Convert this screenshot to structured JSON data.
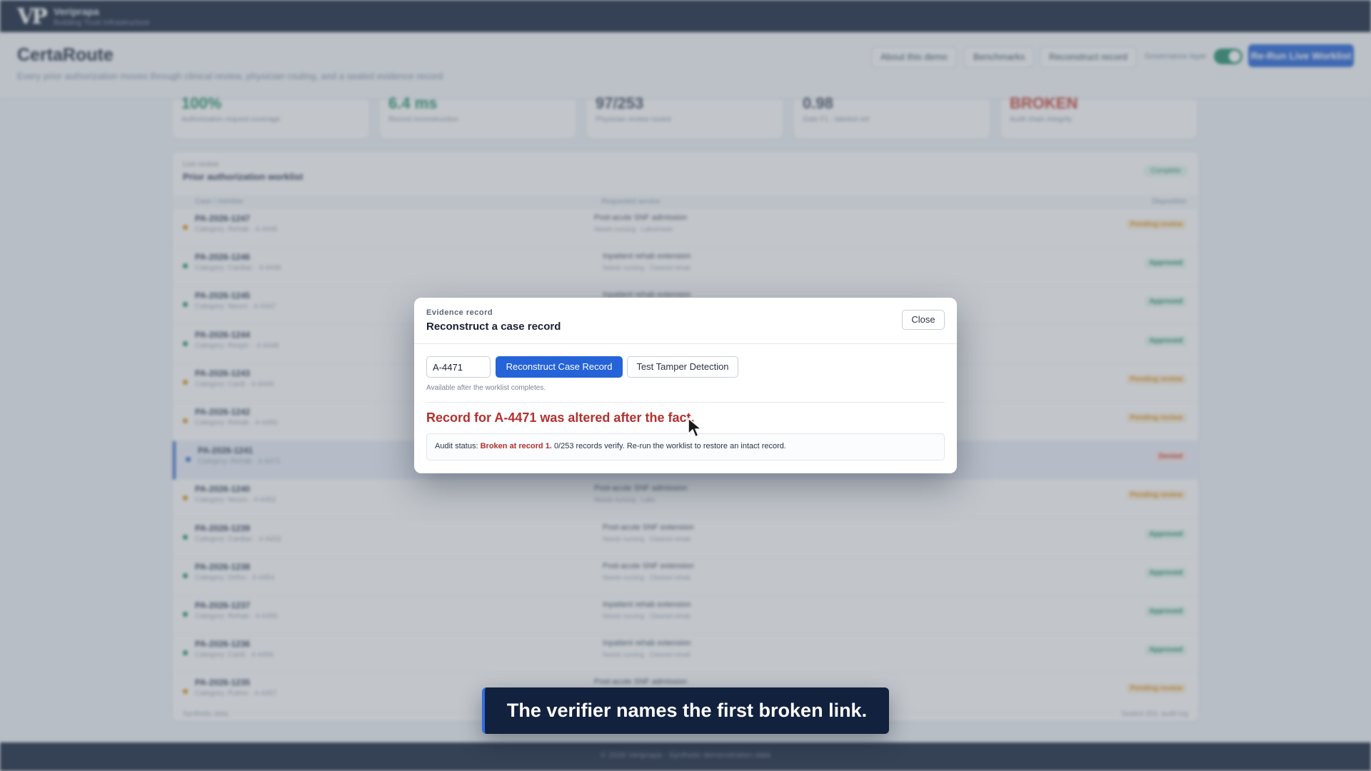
{
  "brand": {
    "mark": "VP",
    "name": "Veriprapa",
    "tagline": "Building Trust Infrastructure"
  },
  "header": {
    "title": "CertaRoute",
    "subtitle": "Every prior authorization moves through clinical review, physician routing, and a sealed evidence record",
    "buttons": [
      "About this demo",
      "Benchmarks",
      "Reconstruct record"
    ],
    "toggle_label": "Governance layer",
    "primary_label": "Re-Run Live Worklist"
  },
  "stats": [
    {
      "value": "100%",
      "label": "Authorization request coverage",
      "color": "#1d8a63"
    },
    {
      "value": "6.4 ms",
      "label": "Record reconstruction",
      "color": "#1d8a63"
    },
    {
      "value": "97/253",
      "label": "Physician review routed",
      "color": "#3a4558"
    },
    {
      "value": "0.98",
      "label": "Gate F1 - labeled set",
      "color": "#3a4558"
    },
    {
      "value": "BROKEN",
      "label": "Audit chain integrity",
      "color": "#c0392b"
    }
  ],
  "worklist": {
    "kicker": "Live review",
    "title": "Prior authorization worklist",
    "badge": "Complete",
    "columns": [
      "Case / member",
      "Requested service",
      "Disposition"
    ],
    "rows": [
      {
        "id": "PA-2026-1247",
        "meta": "Category: Rehab · 4-4445",
        "act": "Post-acute SNF admission",
        "act2": "Needs nursing · Labs/meds",
        "status": "Pending review",
        "tone": "pending"
      },
      {
        "id": "PA-2026-1246",
        "meta": "Category: Cardiac · 4-4446",
        "act": "Inpatient rehab extension",
        "act2": "Needs nursing · Cleared rehab",
        "status": "Approved",
        "tone": "ok"
      },
      {
        "id": "PA-2026-1245",
        "meta": "Category: Neuro · 4-4447",
        "act": "Inpatient rehab extension",
        "act2": "Needs nursing · Cleared rehab",
        "status": "Approved",
        "tone": "ok"
      },
      {
        "id": "PA-2026-1244",
        "meta": "Category: Respir. · 4-4448",
        "act": "Inpatient rehab extension",
        "act2": "Needs nursing · Cleared rehab",
        "status": "Approved",
        "tone": "ok"
      },
      {
        "id": "PA-2026-1243",
        "meta": "Category: Cardi · 4-4449",
        "act": "Post-acute SNF admission",
        "act2": "Needs nursing · Labs/meds",
        "status": "Pending review",
        "tone": "pending"
      },
      {
        "id": "PA-2026-1242",
        "meta": "Category: Rehab · 4-4450",
        "act": "Post-acute SNF admission",
        "act2": "Needs nursing · Labs/meds",
        "status": "Pending review",
        "tone": "pending"
      },
      {
        "id": "PA-2026-1241",
        "meta": "Category: Rehab · 4-4471",
        "act": "Post-acute SNF admission",
        "act2": "Needs nursing · Labs/meds",
        "status": "Denied",
        "tone": "denied",
        "selected": true
      },
      {
        "id": "PA-2026-1240",
        "meta": "Category: Neuro · 4-4452",
        "act": "Post-acute SNF admission",
        "act2": "Needs nursing · Labs",
        "status": "Pending review",
        "tone": "pending"
      },
      {
        "id": "PA-2026-1239",
        "meta": "Category: Cardiac · 4-4453",
        "act": "Post-acute SNF extension",
        "act2": "Needs nursing · Cleared rehab",
        "status": "Approved",
        "tone": "ok"
      },
      {
        "id": "PA-2026-1238",
        "meta": "Category: Ortho · 4-4454",
        "act": "Post-acute SNF extension",
        "act2": "Needs nursing · Cleared rehab",
        "status": "Approved",
        "tone": "ok"
      },
      {
        "id": "PA-2026-1237",
        "meta": "Category: Rehab · 4-4455",
        "act": "Inpatient rehab extension",
        "act2": "Needs nursing · Cleared rehab",
        "status": "Approved",
        "tone": "ok"
      },
      {
        "id": "PA-2026-1236",
        "meta": "Category: Cardi · 4-4456",
        "act": "Inpatient rehab extension",
        "act2": "Needs nursing · Cleared rehab",
        "status": "Approved",
        "tone": "ok"
      },
      {
        "id": "PA-2026-1235",
        "meta": "Category: Pulmo · 4-4457",
        "act": "Post-acute SNF admission",
        "act2": "Needs nursing · Labs/meds",
        "status": "Pending review",
        "tone": "pending"
      }
    ],
    "footer_left": "Synthetic data",
    "footer_right": "Sealed 253, audit log"
  },
  "footer": {
    "text": "© 2026 Veriprapa · Synthetic demonstration data"
  },
  "modal": {
    "kicker": "Evidence record",
    "title": "Reconstruct a case record",
    "close_label": "Close",
    "case_value": "A-4471",
    "reconstruct_label": "Reconstruct Case Record",
    "tamper_label": "Test Tamper Detection",
    "note": "Available after the worklist completes.",
    "alert": "Record for A-4471 was altered after the fact.",
    "audit_prefix": "Audit status:",
    "audit_broken": "Broken at record 1.",
    "audit_rest": "0/253 records verify. Re-run the worklist to restore an intact record."
  },
  "caption": {
    "text": "The verifier names the first broken link."
  },
  "colors": {
    "accent": "#2563d8",
    "alert": "#b3302e",
    "nav": "#0d1b33",
    "ok": "#1d8a63",
    "pending": "#d98c1a"
  }
}
